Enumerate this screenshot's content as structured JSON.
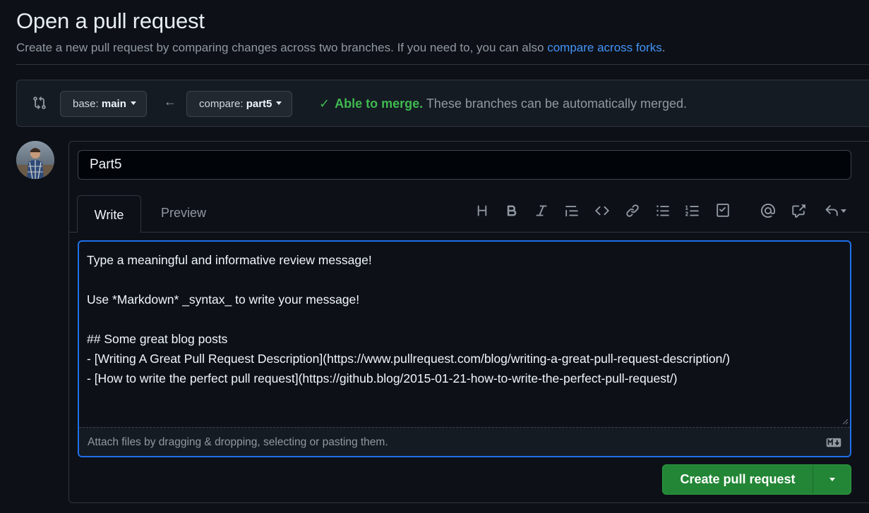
{
  "header": {
    "title": "Open a pull request",
    "subtitle_prefix": "Create a new pull request by comparing changes across two branches. If you need to, you can also ",
    "subtitle_link": "compare across forks",
    "subtitle_suffix": "."
  },
  "compare": {
    "base_label": "base:",
    "base_branch": "main",
    "arrow": "←",
    "compare_label": "compare:",
    "compare_branch": "part5",
    "merge_status_strong": "Able to merge.",
    "merge_status_text": " These branches can be automatically merged."
  },
  "form": {
    "title_value": "Part5",
    "tabs": {
      "write": "Write",
      "preview": "Preview"
    },
    "toolbar_icons": [
      "heading-icon",
      "bold-icon",
      "italic-icon",
      "quote-icon",
      "code-icon",
      "link-icon",
      "unordered-list-icon",
      "ordered-list-icon",
      "task-list-icon",
      "mention-icon",
      "reference-icon",
      "saved-replies-icon"
    ],
    "body_value": "Type a meaningful and informative review message!\n\nUse *Markdown* _syntax_ to write your message!\n\n## Some great blog posts\n- [Writing A Great Pull Request Description](https://www.pullrequest.com/blog/writing-a-great-pull-request-description/)\n- [How to write the perfect pull request](https://github.blog/2015-01-21-how-to-write-the-perfect-pull-request/)",
    "attach_text": "Attach files by dragging & dropping, selecting or pasting them.",
    "submit_label": "Create pull request"
  },
  "colors": {
    "accent": "#1f6feb",
    "success": "#3fb950",
    "button_green": "#238636",
    "link": "#4493f8"
  }
}
